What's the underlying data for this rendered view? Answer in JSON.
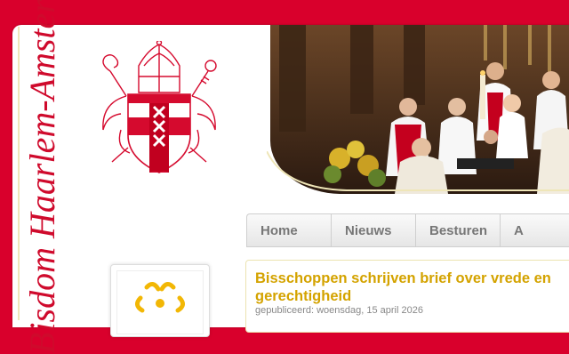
{
  "site": {
    "title": "Bisdom Haarlem-Amsterdam"
  },
  "nav": {
    "items": [
      "Home",
      "Nieuws",
      "Besturen",
      "A"
    ]
  },
  "article": {
    "title": "Bisschoppen schrijven brief over vrede en gerechtigheid",
    "date": "gepubliceerd: woensdag, 15 april 2026"
  },
  "colors": {
    "brand_red": "#d9002c",
    "title_gold": "#d4a300",
    "logo_yellow": "#f2b705"
  },
  "icons": {
    "crest": "diocese-coat-of-arms-icon",
    "logo": "sun-cross-logo-icon"
  }
}
